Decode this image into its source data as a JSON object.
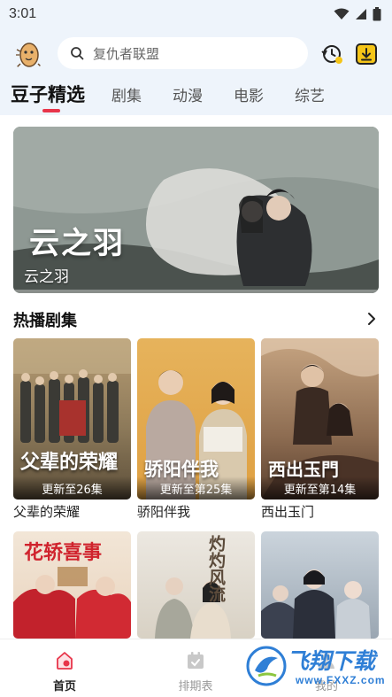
{
  "status_bar": {
    "time": "3:01"
  },
  "header": {
    "search_placeholder": "复仇者联盟",
    "tabs": [
      {
        "label": "豆子精选",
        "active": true
      },
      {
        "label": "剧集",
        "active": false
      },
      {
        "label": "动漫",
        "active": false
      },
      {
        "label": "电影",
        "active": false
      },
      {
        "label": "综艺",
        "active": false
      }
    ]
  },
  "banner": {
    "title": "云之羽",
    "poster_text": "云之羽"
  },
  "section": {
    "title": "热播剧集",
    "cards": [
      {
        "title": "父辈的荣耀",
        "badge": "更新至26集",
        "poster_text": "父辈的荣耀"
      },
      {
        "title": "骄阳伴我",
        "badge": "更新至第25集",
        "poster_text": "骄阳伴我"
      },
      {
        "title": "西出玉门",
        "badge": "更新至第14集",
        "poster_text": "西出玉門"
      }
    ],
    "row2_cards": [
      {
        "poster_text": "花轿喜事"
      },
      {
        "poster_text": "灼灼风流"
      },
      {
        "poster_text": ""
      }
    ]
  },
  "bottom_nav": {
    "items": [
      {
        "label": "首页",
        "active": true
      },
      {
        "label": "排期表",
        "active": false
      },
      {
        "label": "我的",
        "active": false
      }
    ]
  },
  "watermark": {
    "text": "飞翔下载",
    "url": "www.FXXZ.com"
  },
  "colors": {
    "accent": "#e8354a",
    "header_bg": "#eef4fb",
    "watermark_blue": "#2f7fd6"
  }
}
